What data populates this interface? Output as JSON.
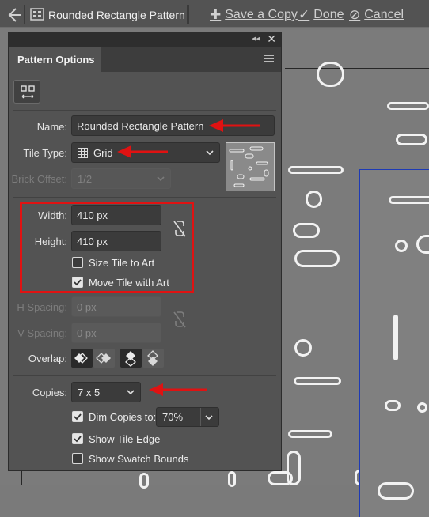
{
  "topbar": {
    "document_title": "Rounded Rectangle Pattern",
    "save_copy_label": "Save a Copy",
    "done_label": "Done",
    "cancel_label": "Cancel",
    "icons": [
      "back-arrow-icon",
      "pattern-icon",
      "plus-icon",
      "checkmark-icon",
      "cancel-circle-icon"
    ]
  },
  "panel": {
    "tab_label": "Pattern Options",
    "name_label": "Name:",
    "name_value": "Rounded Rectangle Pattern",
    "tile_type_label": "Tile Type:",
    "tile_type_value": "Grid",
    "brick_offset_label": "Brick Offset:",
    "brick_offset_value": "1/2",
    "width_label": "Width:",
    "width_value": "410 px",
    "height_label": "Height:",
    "height_value": "410 px",
    "size_tile_to_art_label": "Size Tile to Art",
    "size_tile_to_art_checked": false,
    "move_tile_with_art_label": "Move Tile with Art",
    "move_tile_with_art_checked": true,
    "h_spacing_label": "H Spacing:",
    "h_spacing_placeholder": "0 px",
    "v_spacing_label": "V Spacing:",
    "v_spacing_placeholder": "0 px",
    "overlap_label": "Overlap:",
    "copies_label": "Copies:",
    "copies_value": "7 x 5",
    "dim_copies_label": "Dim Copies to:",
    "dim_copies_checked": true,
    "dim_copies_value": "70%",
    "show_tile_edge_label": "Show Tile Edge",
    "show_tile_edge_checked": true,
    "show_swatch_bounds_label": "Show Swatch Bounds",
    "show_swatch_bounds_checked": false
  },
  "colors": {
    "annotation_red": "#e01212",
    "panel_bg": "#535353",
    "canvas_bg": "#7b7b7b",
    "tile_edge_blue": "#1d3ab5"
  }
}
